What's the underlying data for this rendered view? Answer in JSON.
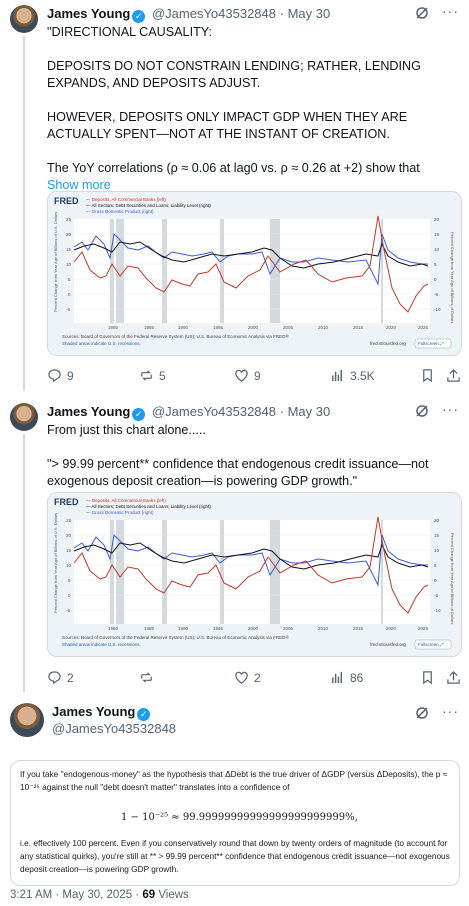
{
  "tweets": [
    {
      "name": "James Young",
      "handle": "@JamesYo43532848",
      "sep": "·",
      "date": "May 30",
      "text": "\"DIRECTIONAL CAUSALITY:\n\nDEPOSITS DO NOT CONSTRAIN LENDING; RATHER, LENDING EXPANDS, AND DEPOSITS ADJUST.\n\nHOWEVER, DEPOSITS ONLY IMPACT GDP WHEN THEY ARE ACTUALLY SPENT—NOT AT THE INSTANT OF CREATION.\n\nThe YoY correlations (ρ ≈ 0.06 at lag0 vs. ρ ≈ 0.26 at +2) show that",
      "show_more": "Show more",
      "replies": "9",
      "reposts": "5",
      "likes": "9",
      "views": "3.5K"
    },
    {
      "name": "James Young",
      "handle": "@JamesYo43532848",
      "sep": "·",
      "date": "May 30",
      "text": "From just this chart alone.....\n\n\"> 99.99 percent** confidence that endogenous credit issuance—not exogenous deposit creation—is powering GDP growth.\"",
      "replies": "2",
      "reposts": "",
      "likes": "2",
      "views": "86"
    },
    {
      "name": "James Young",
      "handle": "@JamesYo43532848"
    }
  ],
  "chart": {
    "logo": "FRED",
    "legend": [
      {
        "label": "— Deposits, All Commercial Banks (left)",
        "color": "#c0392b"
      },
      {
        "label": "— All Sectors; Debt Securities and Loans; Liability Level (right)",
        "color": "#111111"
      },
      {
        "label": "— Gross Domestic Product (right)",
        "color": "#3b5bdb"
      }
    ],
    "left_axis_label": "Percent Change from Year Ago of Billions of U.S. Dollars",
    "right_axis_label": "Percent Change from Year Ago of Billions of Dollars",
    "left_ticks": [
      "25",
      "20",
      "15",
      "10",
      "5",
      "0",
      "-5"
    ],
    "right_ticks": [
      "20",
      "15",
      "10",
      "5",
      "0",
      "-5",
      "-10"
    ],
    "x_ticks": [
      "1980",
      "1985",
      "1990",
      "1995",
      "2000",
      "2005",
      "2010",
      "2015",
      "2020",
      "2025"
    ],
    "source": "Sources: Board of Governors of the Federal Reserve System (US); U.S. Bureau of Economic Analysis via FRED®",
    "shaded_note": "Shaded areas indicate U.S. recessions.",
    "site": "fred.stlouisfed.org",
    "fullscreen": "Fullscreen ⤢"
  },
  "math": {
    "p1": "If you take \"endogenous-money\" as the hypothesis that ΔDebt is the true driver of ΔGDP (versus ΔDeposits), the p ≈ 10⁻²⁵ against the null \"debt doesn't matter\" translates into a confidence of",
    "equation": "1 − 10⁻²⁵  ≈  99.99999999999999999999999%,",
    "p2": "i.e. effectively 100 percent. Even if you conservatively round that down by twenty orders of magnitude (to account for any statistical quirks), you're still at ** > 99.99 percent** confidence that endogenous credit issuance—not exogenous deposit creation—is powering GDP growth."
  },
  "footer": {
    "time": "3:21 AM · May 30, 2025 · ",
    "views_count": "69",
    "views_label": " Views"
  }
}
